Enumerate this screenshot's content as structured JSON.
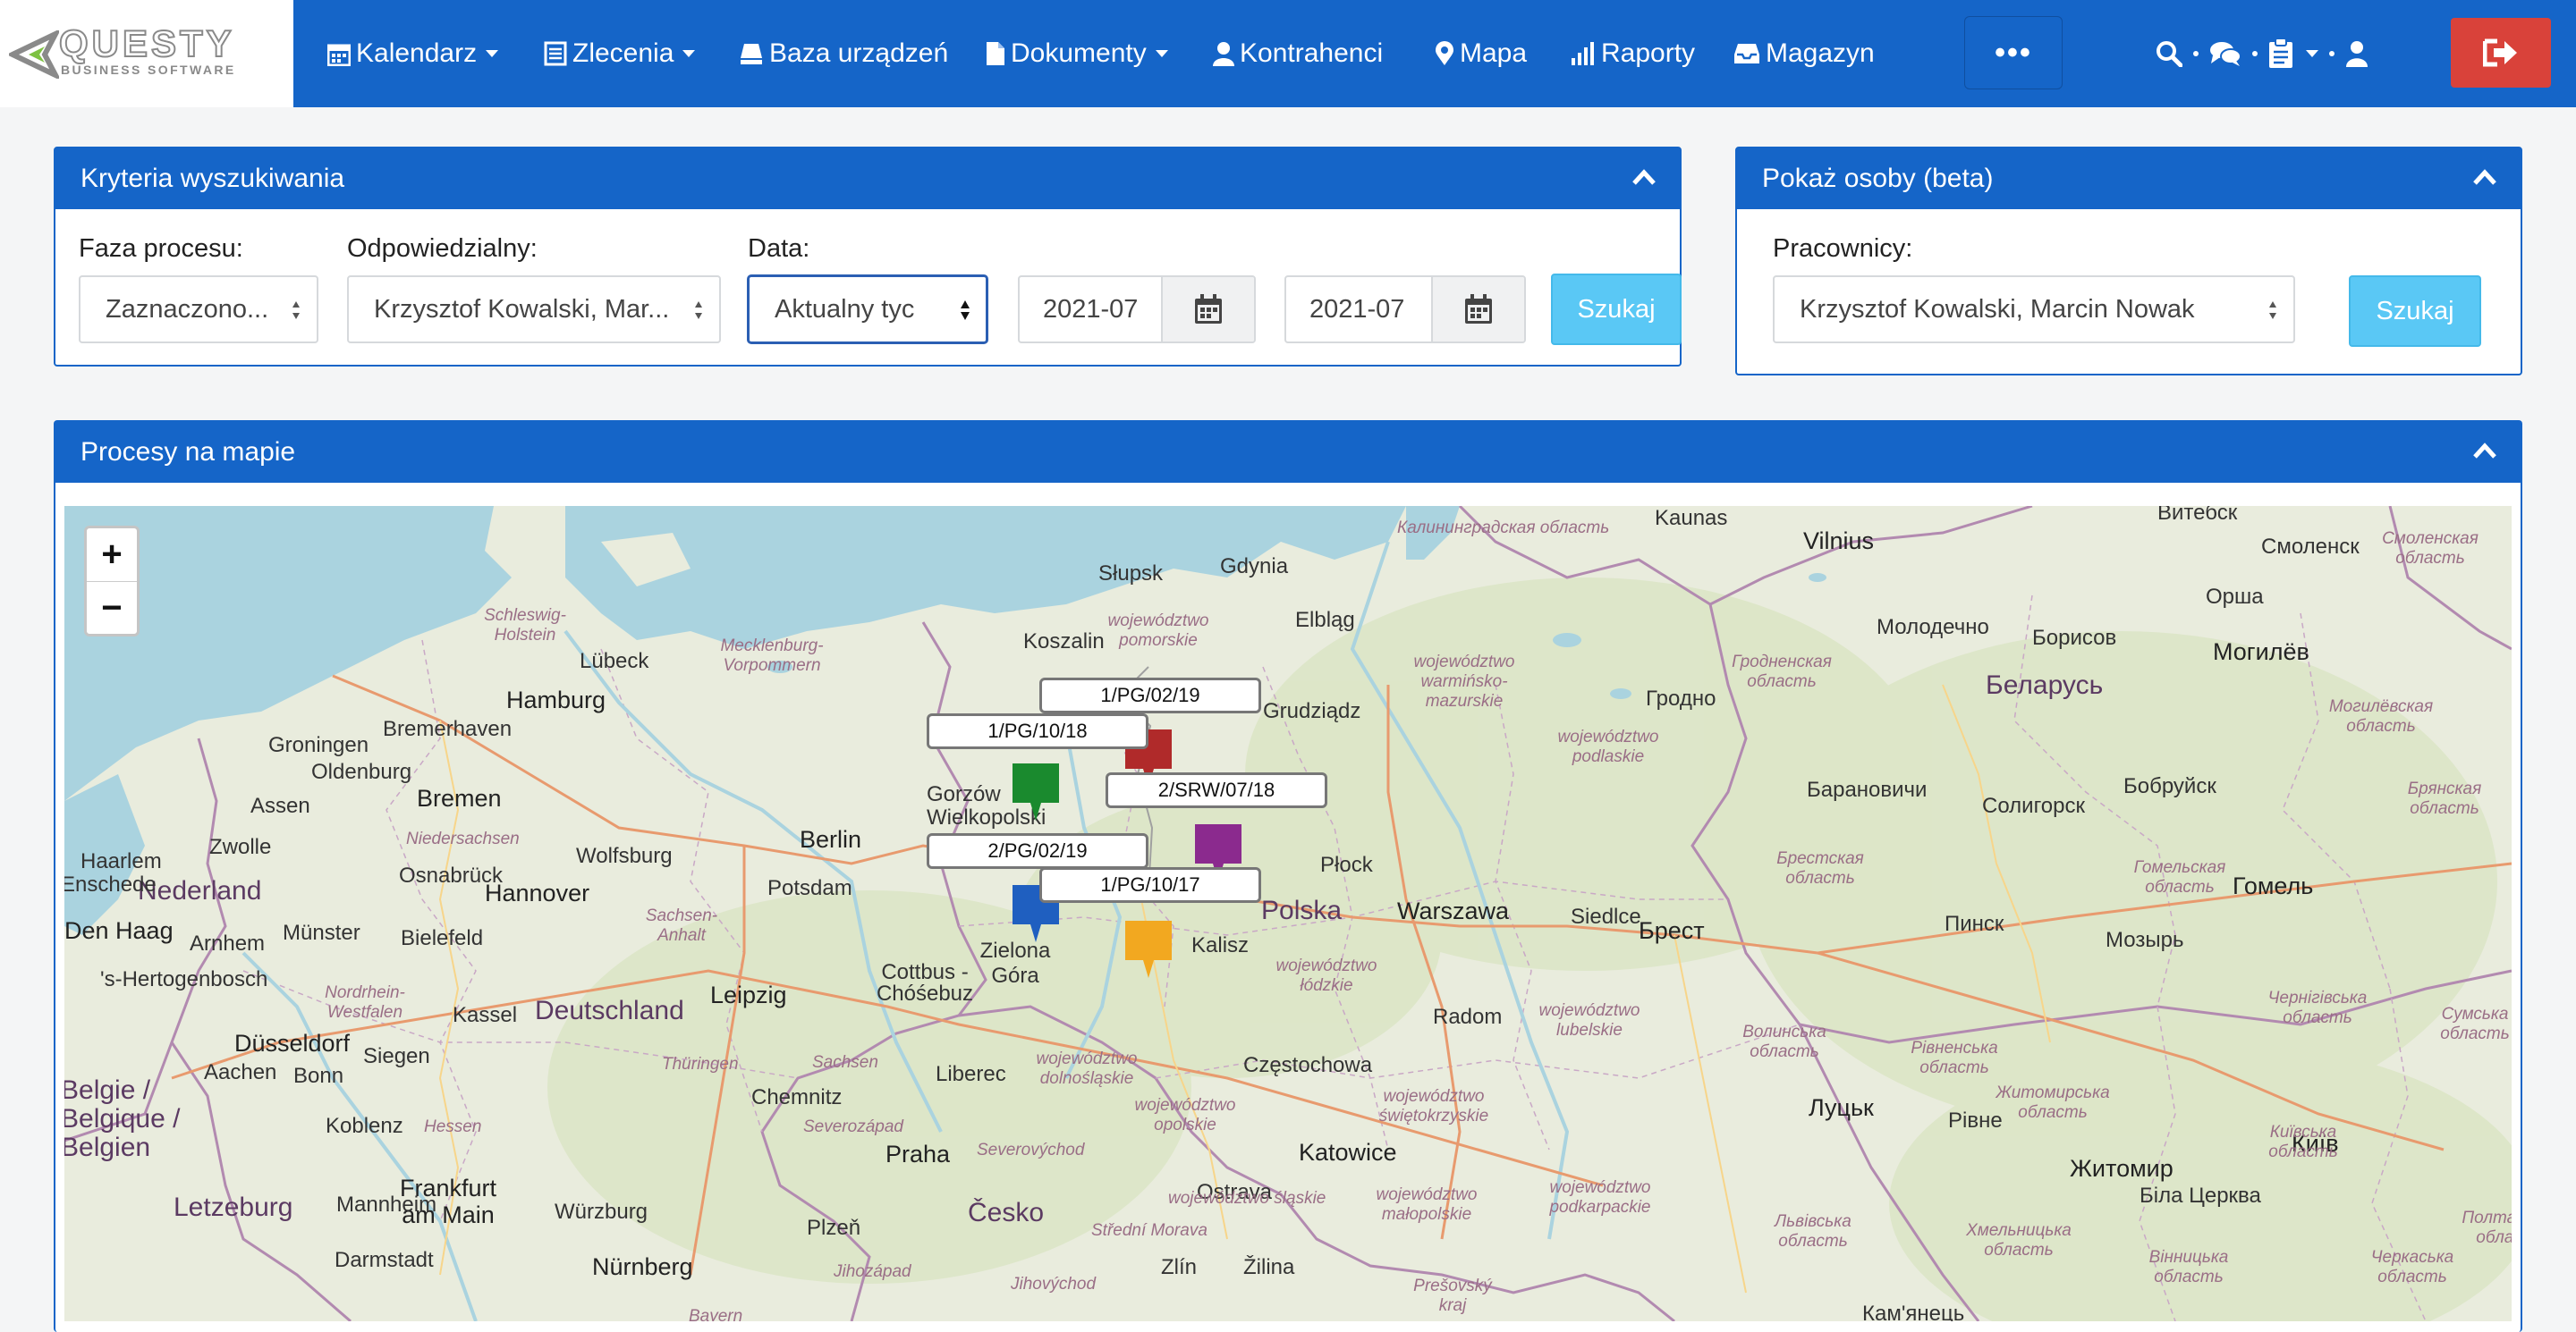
{
  "logo": {
    "title": "QUESTY",
    "subtitle": "BUSINESS SOFTWARE"
  },
  "nav": {
    "items": [
      {
        "label": "Kalendarz",
        "icon": "calendar-icon",
        "dropdown": true
      },
      {
        "label": "Zlecenia",
        "icon": "list-icon",
        "dropdown": true
      },
      {
        "label": "Baza urządzeń",
        "icon": "device-icon",
        "dropdown": false
      },
      {
        "label": "Dokumenty",
        "icon": "file-icon",
        "dropdown": true
      },
      {
        "label": "Kontrahenci",
        "icon": "user-icon",
        "dropdown": false
      },
      {
        "label": "Mapa",
        "icon": "map-marker-icon",
        "dropdown": false
      },
      {
        "label": "Raporty",
        "icon": "bar-chart-icon",
        "dropdown": false
      },
      {
        "label": "Magazyn",
        "icon": "inbox-icon",
        "dropdown": false
      }
    ],
    "more": "•••"
  },
  "search_panel": {
    "title": "Kryteria wyszukiwania",
    "phase_label": "Faza procesu:",
    "phase_value": "Zaznaczono...",
    "responsible_label": "Odpowiedzialny:",
    "responsible_value": "Krzysztof Kowalski, Mar...",
    "date_label": "Data:",
    "date_value": "Aktualny tyc",
    "date_from": "2021-07",
    "date_to": "2021-07",
    "search_button": "Szukaj"
  },
  "people_panel": {
    "title": "Pokaż osoby (beta)",
    "workers_label": "Pracownicy:",
    "workers_value": "Krzysztof Kowalski, Marcin Nowak",
    "search_button": "Szukaj"
  },
  "map_panel": {
    "title": "Procesy na mapie",
    "zoom_in": "+",
    "zoom_out": "−"
  },
  "markers": [
    {
      "label": "1/PG/02/19",
      "color": "#b02a2a"
    },
    {
      "label": "1/PG/10/18",
      "color": "#1a8a2e"
    },
    {
      "label": "2/SRW/07/18",
      "color": "#8b2a8e"
    },
    {
      "label": "2/PG/02/19",
      "color": "#1f5fc0"
    },
    {
      "label": "1/PG/10/17",
      "color": "#f2a820"
    }
  ],
  "map_labels": {
    "countries": [
      "Nederland",
      "Deutschland",
      "Polska",
      "Česko",
      "Belgie / Belgique / Belgien",
      "Letzeburg",
      "Беларусь"
    ],
    "cities": [
      "Hamburg",
      "Groningen",
      "Bremerhaven",
      "Oldenburg",
      "Assen",
      "Bremen",
      "Lübeck",
      "Zwolle",
      "Haarlem",
      "Osnabrück",
      "Wolfsburg",
      "Hannover",
      "Berlin",
      "Potsdam",
      "Enschede",
      "Arnhem",
      "Münster",
      "Bielefeld",
      "Den Haag",
      "'s-Hertogenbosch",
      "Kassel",
      "Leipzig",
      "Düsseldorf",
      "Aachen",
      "Bonn",
      "Siegen",
      "Koblenz",
      "Frankfurt am Main",
      "Darmstadt",
      "Würzburg",
      "Mannheim",
      "Nürnberg",
      "Chemnitz",
      "Cottbus - Chóśebuz",
      "Praha",
      "Plzeň",
      "Liberec",
      "Słupsk",
      "Gdynia",
      "Koszalin",
      "Elbląg",
      "Grudziądz",
      "Gorzów Wielkopolski",
      "Zielona Góra",
      "Kalisz",
      "Płock",
      "Warszawa",
      "Siedlce",
      "Radom",
      "Częstochowa",
      "Katowice",
      "Ostrava",
      "Zlín",
      "Žilina",
      "Kaunas",
      "Vilnius",
      "Витебск",
      "Смоленск",
      "Молодечно",
      "Борисов",
      "Орша",
      "Могилёв",
      "Гродно",
      "Барановичи",
      "Солигорск",
      "Бобруйск",
      "Пинск",
      "Гомель",
      "Брест",
      "Мозырь",
      "Луцьк",
      "Рівне",
      "Житомир",
      "Київ",
      "Біла Церква",
      "Кам'янець"
    ],
    "regions": [
      "Калининградская область",
      "Смоленская область",
      "Schleswig-Holstein",
      "Mecklenburg-Vorpommern",
      "województwo pomorskie",
      "województwo warmińsko-mazurskie",
      "Гродненская область",
      "Могилёвская область",
      "województwo podlaskie",
      "Брянская область",
      "Niedersachsen",
      "Sachsen-Anhalt",
      "Брестская область",
      "Гомельская область",
      "Nordrhein-Westfalen",
      "Thüringen",
      "Sachsen",
      "województwo dolnośląskie",
      "województwo łódzkie",
      "województwo lubelskie",
      "Волинська область",
      "Рівненська область",
      "Чернігівська область",
      "Сумська область",
      "Hessen",
      "Severozápad",
      "Severovýchod",
      "województwo opolskie",
      "województwo świętokrzyskie",
      "Житомирська область",
      "Київська область",
      "województwo śląskie",
      "województwo małopolskie",
      "województwo podkarpackie",
      "Львівська область",
      "Střední Morava",
      "Jihozápad",
      "Jihovýchod",
      "Prešovský kraj",
      "Хмельницька область",
      "Вінницька область",
      "Черкаська область",
      "Полтавська область",
      "Bayern"
    ]
  }
}
